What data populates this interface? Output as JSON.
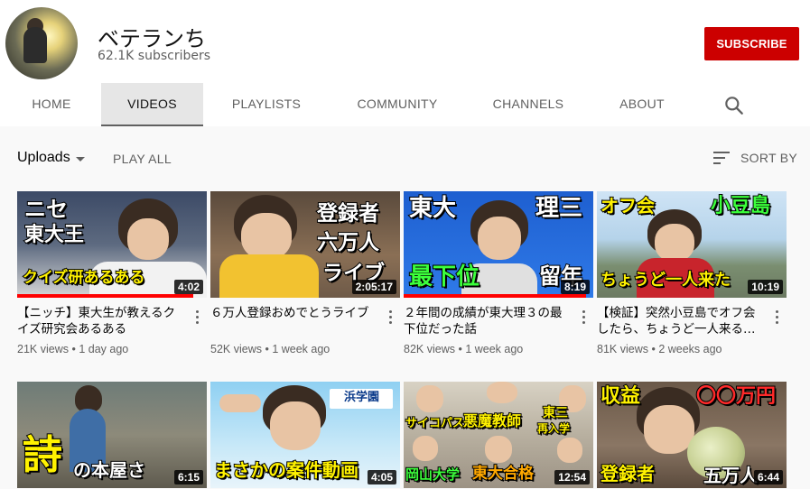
{
  "channel": {
    "name": "ベテランち",
    "subscribers": "62.1K subscribers",
    "subscribe_label": "SUBSCRIBE"
  },
  "tabs": [
    {
      "label": "HOME"
    },
    {
      "label": "VIDEOS"
    },
    {
      "label": "PLAYLISTS"
    },
    {
      "label": "COMMUNITY"
    },
    {
      "label": "CHANNELS"
    },
    {
      "label": "ABOUT"
    }
  ],
  "active_tab": "VIDEOS",
  "toolbar": {
    "uploads_label": "Uploads",
    "play_all_label": "PLAY ALL",
    "sort_by_label": "SORT BY"
  },
  "icons": {
    "search": "search-icon",
    "sort": "sort-icon",
    "more": "more-vert-icon",
    "dropdown": "caret-down-icon"
  },
  "colors": {
    "accent": "#cc0000",
    "progress": "#ff0000"
  },
  "videos": [
    {
      "title": "【ニッチ】東大生が教えるクイズ研究会あるある",
      "views": "21K views",
      "age": "1 day ago",
      "duration": "4:02",
      "captions": [
        "ニセ",
        "東大王",
        "クイズ研あるある"
      ],
      "watched_fraction": 0.93
    },
    {
      "title": "６万人登録おめでとうライブ",
      "views": "52K views",
      "age": "1 week ago",
      "duration": "2:05:17",
      "captions": [
        "登録者",
        "六万人",
        "ライブ"
      ],
      "watched_fraction": 0.0
    },
    {
      "title": "２年間の成績が東大理３の最下位だった話",
      "views": "82K views",
      "age": "1 week ago",
      "duration": "8:19",
      "captions": [
        "東大",
        "理三",
        "最下位",
        "留年"
      ],
      "watched_fraction": 0.96
    },
    {
      "title": "【検証】突然小豆島でオフ会したら、ちょうど一人来る…",
      "views": "81K views",
      "age": "2 weeks ago",
      "duration": "10:19",
      "captions": [
        "オフ会",
        "小豆島",
        "ちょうど一人来た"
      ],
      "watched_fraction": 0.0
    },
    {
      "title": "",
      "views": "",
      "age": "",
      "duration": "6:15",
      "captions": [
        "詩",
        "の本屋さ"
      ],
      "watched_fraction": 0.0
    },
    {
      "title": "",
      "views": "",
      "age": "",
      "duration": "4:05",
      "captions": [
        "浜学園",
        "まさかの案件動画"
      ],
      "watched_fraction": 0.0
    },
    {
      "title": "",
      "views": "",
      "age": "",
      "duration": "12:54",
      "captions": [
        "サイコパス",
        "悪魔教師",
        "東三",
        "再入学",
        "岡山大学",
        "東大合格"
      ],
      "watched_fraction": 0.0
    },
    {
      "title": "",
      "views": "",
      "age": "",
      "duration": "6:44",
      "captions": [
        "収益",
        "〇〇万円",
        "登録者",
        "五万人"
      ],
      "watched_fraction": 0.0
    }
  ]
}
